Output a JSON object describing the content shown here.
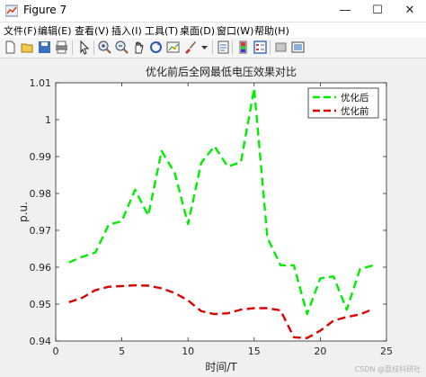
{
  "window": {
    "title": "Figure 7"
  },
  "menu": {
    "items": [
      "文件(F)",
      "编辑(E)",
      "查看(V)",
      "插入(I)",
      "工具(T)",
      "桌面(D)",
      "窗口(W)",
      "帮助(H)"
    ]
  },
  "toolbar": {
    "icons": [
      "new-figure-icon",
      "open-icon",
      "save-icon",
      "print-icon",
      "pointer-icon",
      "zoom-in-icon",
      "zoom-out-icon",
      "pan-icon",
      "rotate-icon",
      "data-cursor-icon",
      "brush-icon",
      "colorbar-icon",
      "legend-icon",
      "hide-plot-tools-icon",
      "show-plot-tools-icon"
    ]
  },
  "watermark": "CSDN @荔枝科研社",
  "colors": {
    "series_after": "#00ee00",
    "series_before": "#dd0000"
  },
  "chart_data": {
    "type": "line",
    "title": "优化前后全网最低电压效果对比",
    "xlabel": "时间/T",
    "ylabel": "p.u.",
    "xlim": [
      0,
      25
    ],
    "ylim": [
      0.94,
      1.01
    ],
    "xticks": [
      0,
      5,
      10,
      15,
      20,
      25
    ],
    "yticks": [
      0.94,
      0.95,
      0.96,
      0.97,
      0.98,
      0.99,
      1,
      1.01
    ],
    "ytick_labels": [
      "0.94",
      "0.95",
      "0.96",
      "0.97",
      "0.98",
      "0.99",
      "1",
      "1.01"
    ],
    "grid": false,
    "legend_position": "top-right",
    "series": [
      {
        "name": "优化后",
        "color": "#00ee00",
        "x": [
          1,
          2,
          3,
          4,
          5,
          6,
          7,
          8,
          9,
          10,
          11,
          12,
          13,
          14,
          15,
          16,
          17,
          18,
          19,
          20,
          21,
          22,
          23,
          24
        ],
        "values": [
          0.9613,
          0.9628,
          0.964,
          0.9715,
          0.9725,
          0.981,
          0.974,
          0.9915,
          0.9855,
          0.9717,
          0.9883,
          0.9928,
          0.9873,
          0.9885,
          1.0085,
          0.968,
          0.9605,
          0.9605,
          0.9473,
          0.957,
          0.9575,
          0.9485,
          0.9595,
          0.9605
        ]
      },
      {
        "name": "优化前",
        "color": "#dd0000",
        "x": [
          1,
          2,
          3,
          4,
          5,
          6,
          7,
          8,
          9,
          10,
          11,
          12,
          13,
          14,
          15,
          16,
          17,
          18,
          19,
          20,
          21,
          22,
          23,
          24
        ],
        "values": [
          0.9505,
          0.9517,
          0.9538,
          0.9547,
          0.9549,
          0.9551,
          0.955,
          0.9543,
          0.953,
          0.951,
          0.9481,
          0.9473,
          0.9475,
          0.9485,
          0.9489,
          0.9489,
          0.9483,
          0.941,
          0.9408,
          0.9428,
          0.9455,
          0.9465,
          0.9472,
          0.9487
        ]
      }
    ]
  }
}
